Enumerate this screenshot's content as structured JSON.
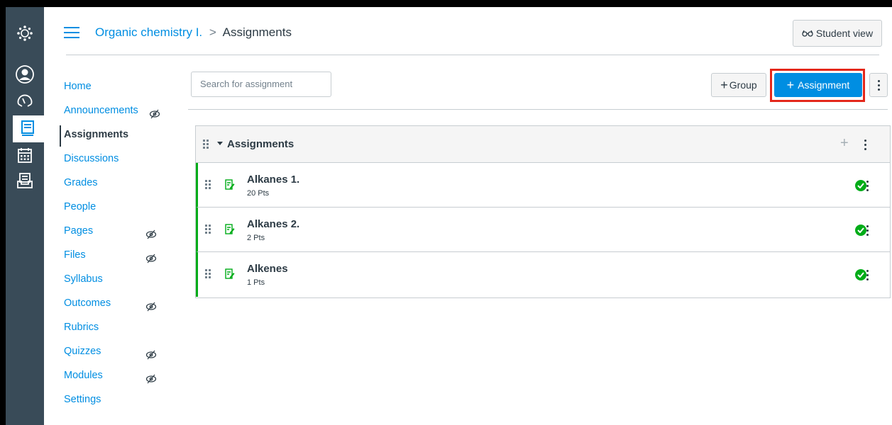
{
  "breadcrumb": {
    "course": "Organic chemistry I.",
    "separator": ">",
    "current": "Assignments"
  },
  "header": {
    "student_view_label": "Student view",
    "student_view_icon": "glasses-icon"
  },
  "global_nav": {
    "items": [
      "logo-icon",
      "account-icon",
      "dashboard-icon",
      "courses-icon",
      "calendar-icon",
      "inbox-icon"
    ],
    "active": "courses-icon"
  },
  "course_nav": {
    "items": [
      {
        "label": "Home",
        "hidden": false,
        "active": false
      },
      {
        "label": "Announcements",
        "hidden": true,
        "active": false
      },
      {
        "label": "Assignments",
        "hidden": false,
        "active": true
      },
      {
        "label": "Discussions",
        "hidden": false,
        "active": false
      },
      {
        "label": "Grades",
        "hidden": false,
        "active": false
      },
      {
        "label": "People",
        "hidden": false,
        "active": false
      },
      {
        "label": "Pages",
        "hidden": true,
        "active": false
      },
      {
        "label": "Files",
        "hidden": true,
        "active": false
      },
      {
        "label": "Syllabus",
        "hidden": false,
        "active": false
      },
      {
        "label": "Outcomes",
        "hidden": true,
        "active": false
      },
      {
        "label": "Rubrics",
        "hidden": false,
        "active": false
      },
      {
        "label": "Quizzes",
        "hidden": true,
        "active": false
      },
      {
        "label": "Modules",
        "hidden": true,
        "active": false
      },
      {
        "label": "Settings",
        "hidden": false,
        "active": false
      }
    ]
  },
  "toolbar": {
    "search_placeholder": "Search for assignment",
    "group_label": "Group",
    "assignment_label": "Assignment"
  },
  "assignment_group": {
    "title": "Assignments",
    "assignments": [
      {
        "name": "Alkanes 1.",
        "points": "20 Pts",
        "published": true
      },
      {
        "name": "Alkanes 2.",
        "points": "2 Pts",
        "published": true
      },
      {
        "name": "Alkenes",
        "points": "1 Pts",
        "published": true
      }
    ]
  },
  "colors": {
    "link": "#008ee2",
    "global_nav_bg": "#394b58",
    "published_green": "#00ac18",
    "highlight_red": "#e4281b"
  }
}
